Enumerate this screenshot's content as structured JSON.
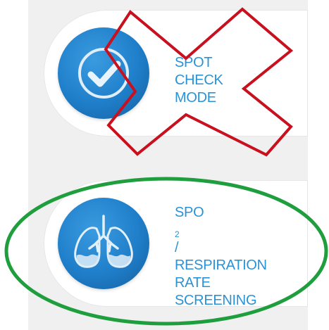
{
  "modes": [
    {
      "id": "spot-check",
      "icon": "checkmark-icon",
      "label_lines": [
        "SPOT",
        "CHECK",
        "MODE"
      ],
      "annotation": "crossed-out",
      "annotation_color": "#c8101e"
    },
    {
      "id": "spo2-resp",
      "icon": "lungs-icon",
      "label_prefix": "SpO",
      "label_subscript": "2",
      "label_suffix": " /",
      "label_lines": [
        "RESPIRATION",
        "RATE",
        "SCREENING"
      ],
      "annotation": "circled",
      "annotation_color": "#1f9e3e"
    }
  ],
  "colors": {
    "circle_blue": "#1f7ec9",
    "label_blue": "#2a93d5",
    "panel_gray": "#f0f0f0"
  }
}
